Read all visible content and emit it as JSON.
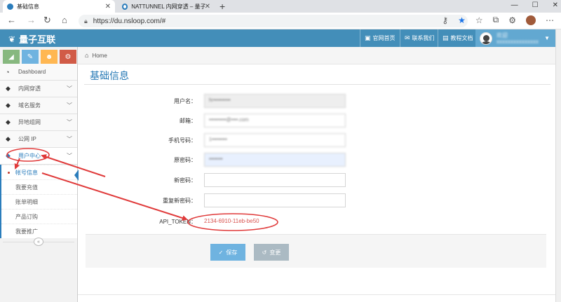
{
  "browser": {
    "tabs": [
      {
        "label": "基础信息",
        "active": true
      },
      {
        "label": "NATTUNNEL 内网穿透 – 量子互联",
        "active": false
      }
    ],
    "url": "https://du.nsloop.com/#"
  },
  "header": {
    "brand": "量子互联",
    "links": [
      {
        "icon": "desktop-icon",
        "label": "官网首页"
      },
      {
        "icon": "comments-icon",
        "label": "联系我们"
      },
      {
        "icon": "book-icon",
        "label": "教程文档"
      }
    ],
    "user_line1": "欢迎",
    "user_line2": "xxxxxxxxxxxxxxx"
  },
  "sidebar": {
    "menu": [
      {
        "label": "Dashboard",
        "icon": "tachometer-icon",
        "expandable": false
      },
      {
        "label": "内网穿透",
        "icon": "tag-icon",
        "expandable": true
      },
      {
        "label": "域名服务",
        "icon": "tag-icon",
        "expandable": true
      },
      {
        "label": "异地组网",
        "icon": "tag-icon",
        "expandable": true
      },
      {
        "label": "公网 IP",
        "icon": "tag-icon",
        "expandable": true
      },
      {
        "label": "用户中心",
        "icon": "tag-icon",
        "expandable": true,
        "open": true
      }
    ],
    "submenu": [
      {
        "label": "帐号信息",
        "active": true
      },
      {
        "label": "我要充值"
      },
      {
        "label": "账单明细"
      },
      {
        "label": "产品订购"
      },
      {
        "label": "我要推广"
      }
    ]
  },
  "breadcrumb": {
    "home": "Home"
  },
  "page_title": "基础信息",
  "form": {
    "username_label": "用户名：",
    "username_value": "hr••••••••••",
    "email_label": "邮箱：",
    "email_value": "••••••••••@••••.com",
    "phone_label": "手机号码：",
    "phone_value": "1•••••••••",
    "old_password_label": "原密码：",
    "old_password_value": "••••••••",
    "new_password_label": "新密码：",
    "confirm_password_label": "重复新密码：",
    "api_token_label": "API_TOKEN：",
    "api_token_value": "2134-6910-11eb-be50"
  },
  "buttons": {
    "save": "保存",
    "reset": "变更"
  },
  "colors": {
    "header_blue": "#438eb9",
    "accent_blue": "#2679b5",
    "annotation_red": "#e03a3a"
  }
}
